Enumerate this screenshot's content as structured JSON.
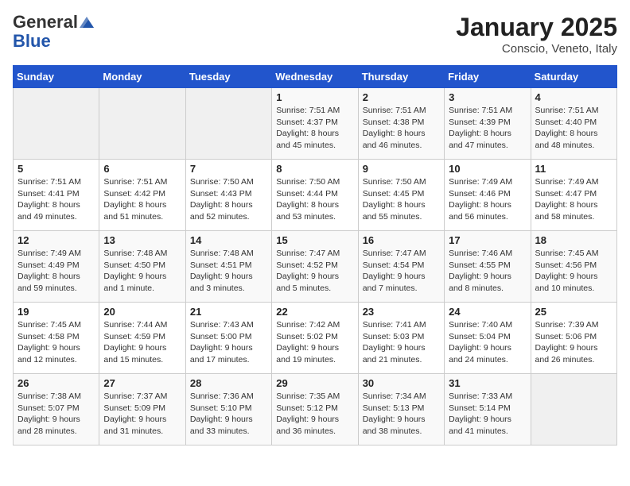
{
  "header": {
    "logo_general": "General",
    "logo_blue": "Blue",
    "month": "January 2025",
    "location": "Conscio, Veneto, Italy"
  },
  "weekdays": [
    "Sunday",
    "Monday",
    "Tuesday",
    "Wednesday",
    "Thursday",
    "Friday",
    "Saturday"
  ],
  "weeks": [
    [
      {
        "day": "",
        "info": ""
      },
      {
        "day": "",
        "info": ""
      },
      {
        "day": "",
        "info": ""
      },
      {
        "day": "1",
        "info": "Sunrise: 7:51 AM\nSunset: 4:37 PM\nDaylight: 8 hours\nand 45 minutes."
      },
      {
        "day": "2",
        "info": "Sunrise: 7:51 AM\nSunset: 4:38 PM\nDaylight: 8 hours\nand 46 minutes."
      },
      {
        "day": "3",
        "info": "Sunrise: 7:51 AM\nSunset: 4:39 PM\nDaylight: 8 hours\nand 47 minutes."
      },
      {
        "day": "4",
        "info": "Sunrise: 7:51 AM\nSunset: 4:40 PM\nDaylight: 8 hours\nand 48 minutes."
      }
    ],
    [
      {
        "day": "5",
        "info": "Sunrise: 7:51 AM\nSunset: 4:41 PM\nDaylight: 8 hours\nand 49 minutes."
      },
      {
        "day": "6",
        "info": "Sunrise: 7:51 AM\nSunset: 4:42 PM\nDaylight: 8 hours\nand 51 minutes."
      },
      {
        "day": "7",
        "info": "Sunrise: 7:50 AM\nSunset: 4:43 PM\nDaylight: 8 hours\nand 52 minutes."
      },
      {
        "day": "8",
        "info": "Sunrise: 7:50 AM\nSunset: 4:44 PM\nDaylight: 8 hours\nand 53 minutes."
      },
      {
        "day": "9",
        "info": "Sunrise: 7:50 AM\nSunset: 4:45 PM\nDaylight: 8 hours\nand 55 minutes."
      },
      {
        "day": "10",
        "info": "Sunrise: 7:49 AM\nSunset: 4:46 PM\nDaylight: 8 hours\nand 56 minutes."
      },
      {
        "day": "11",
        "info": "Sunrise: 7:49 AM\nSunset: 4:47 PM\nDaylight: 8 hours\nand 58 minutes."
      }
    ],
    [
      {
        "day": "12",
        "info": "Sunrise: 7:49 AM\nSunset: 4:49 PM\nDaylight: 8 hours\nand 59 minutes."
      },
      {
        "day": "13",
        "info": "Sunrise: 7:48 AM\nSunset: 4:50 PM\nDaylight: 9 hours\nand 1 minute."
      },
      {
        "day": "14",
        "info": "Sunrise: 7:48 AM\nSunset: 4:51 PM\nDaylight: 9 hours\nand 3 minutes."
      },
      {
        "day": "15",
        "info": "Sunrise: 7:47 AM\nSunset: 4:52 PM\nDaylight: 9 hours\nand 5 minutes."
      },
      {
        "day": "16",
        "info": "Sunrise: 7:47 AM\nSunset: 4:54 PM\nDaylight: 9 hours\nand 7 minutes."
      },
      {
        "day": "17",
        "info": "Sunrise: 7:46 AM\nSunset: 4:55 PM\nDaylight: 9 hours\nand 8 minutes."
      },
      {
        "day": "18",
        "info": "Sunrise: 7:45 AM\nSunset: 4:56 PM\nDaylight: 9 hours\nand 10 minutes."
      }
    ],
    [
      {
        "day": "19",
        "info": "Sunrise: 7:45 AM\nSunset: 4:58 PM\nDaylight: 9 hours\nand 12 minutes."
      },
      {
        "day": "20",
        "info": "Sunrise: 7:44 AM\nSunset: 4:59 PM\nDaylight: 9 hours\nand 15 minutes."
      },
      {
        "day": "21",
        "info": "Sunrise: 7:43 AM\nSunset: 5:00 PM\nDaylight: 9 hours\nand 17 minutes."
      },
      {
        "day": "22",
        "info": "Sunrise: 7:42 AM\nSunset: 5:02 PM\nDaylight: 9 hours\nand 19 minutes."
      },
      {
        "day": "23",
        "info": "Sunrise: 7:41 AM\nSunset: 5:03 PM\nDaylight: 9 hours\nand 21 minutes."
      },
      {
        "day": "24",
        "info": "Sunrise: 7:40 AM\nSunset: 5:04 PM\nDaylight: 9 hours\nand 24 minutes."
      },
      {
        "day": "25",
        "info": "Sunrise: 7:39 AM\nSunset: 5:06 PM\nDaylight: 9 hours\nand 26 minutes."
      }
    ],
    [
      {
        "day": "26",
        "info": "Sunrise: 7:38 AM\nSunset: 5:07 PM\nDaylight: 9 hours\nand 28 minutes."
      },
      {
        "day": "27",
        "info": "Sunrise: 7:37 AM\nSunset: 5:09 PM\nDaylight: 9 hours\nand 31 minutes."
      },
      {
        "day": "28",
        "info": "Sunrise: 7:36 AM\nSunset: 5:10 PM\nDaylight: 9 hours\nand 33 minutes."
      },
      {
        "day": "29",
        "info": "Sunrise: 7:35 AM\nSunset: 5:12 PM\nDaylight: 9 hours\nand 36 minutes."
      },
      {
        "day": "30",
        "info": "Sunrise: 7:34 AM\nSunset: 5:13 PM\nDaylight: 9 hours\nand 38 minutes."
      },
      {
        "day": "31",
        "info": "Sunrise: 7:33 AM\nSunset: 5:14 PM\nDaylight: 9 hours\nand 41 minutes."
      },
      {
        "day": "",
        "info": ""
      }
    ]
  ]
}
